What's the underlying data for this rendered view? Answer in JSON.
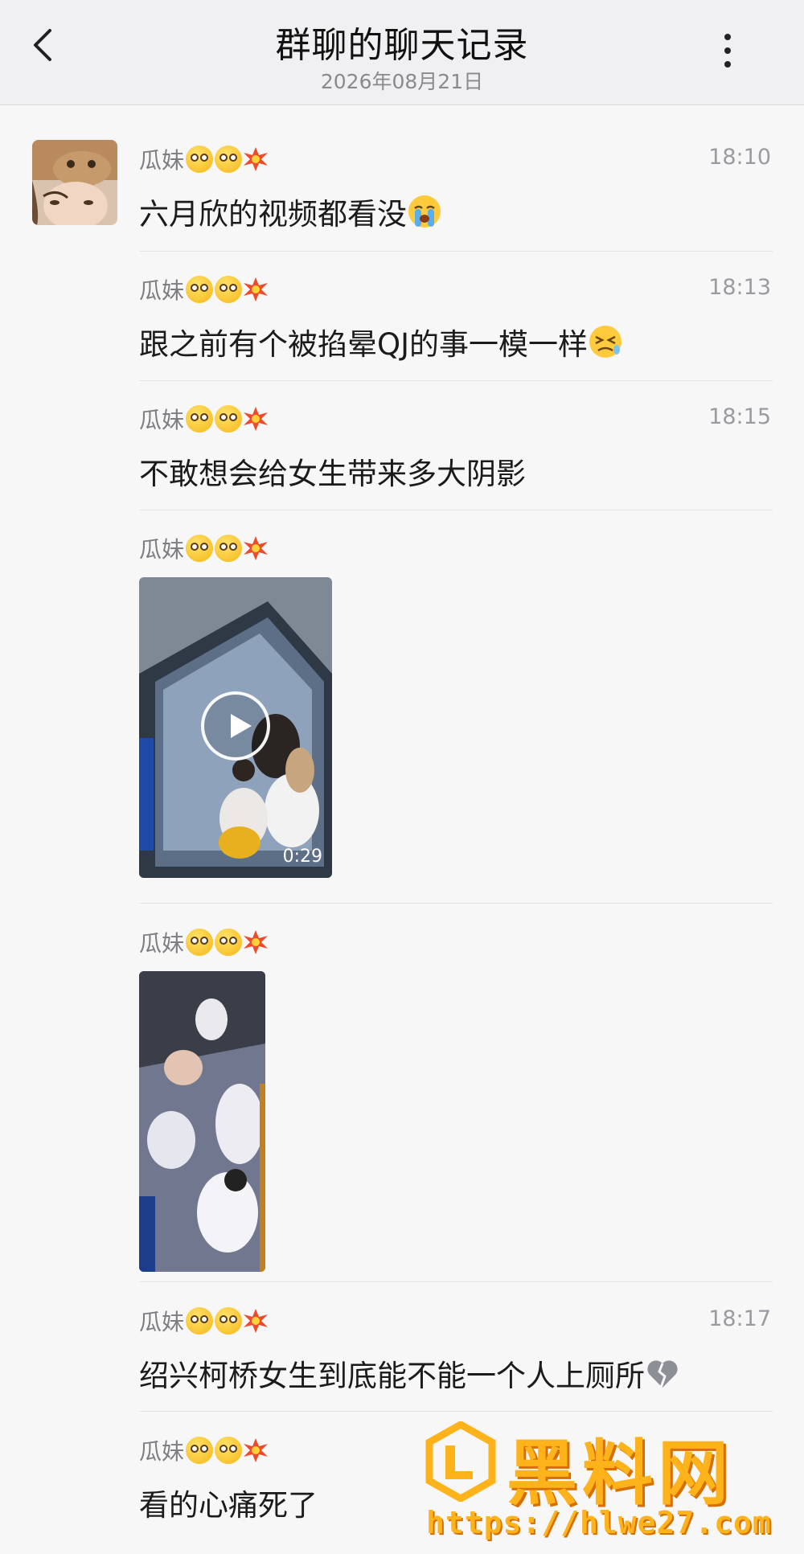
{
  "header": {
    "title": "群聊的聊天记录",
    "date": "2026年08月21日",
    "back_icon": "chevron-left-icon",
    "more_icon": "more-vertical-icon"
  },
  "sender": {
    "name": "瓜妹",
    "emojis": [
      "dizzy-face-emoji",
      "dizzy-face-emoji",
      "collision-emoji"
    ]
  },
  "messages": [
    {
      "type": "text",
      "time": "18:10",
      "text": "六月欣的视频都看没",
      "emoji": "loudly-crying-face-emoji"
    },
    {
      "type": "text",
      "time": "18:13",
      "text": "跟之前有个被掐晕QJ的事一模一样",
      "emoji": "persevering-face-emoji"
    },
    {
      "type": "text",
      "time": "18:15",
      "text": "不敢想会给女生带来多大阴影"
    },
    {
      "type": "video",
      "time": "",
      "duration": "0:29"
    },
    {
      "type": "image",
      "time": ""
    },
    {
      "type": "text",
      "time": "18:17",
      "text": "绍兴柯桥女生到底能不能一个人上厕所",
      "emoji": "broken-heart-emoji"
    },
    {
      "type": "text",
      "time": "",
      "text": "看的心痛死了"
    }
  ],
  "watermark": {
    "text": "黑料网",
    "url": "https://hlwe27.com"
  },
  "colors": {
    "header_bg": "#f0f0f2",
    "page_bg": "#f7f7f8",
    "watermark": "#ffb31a"
  }
}
